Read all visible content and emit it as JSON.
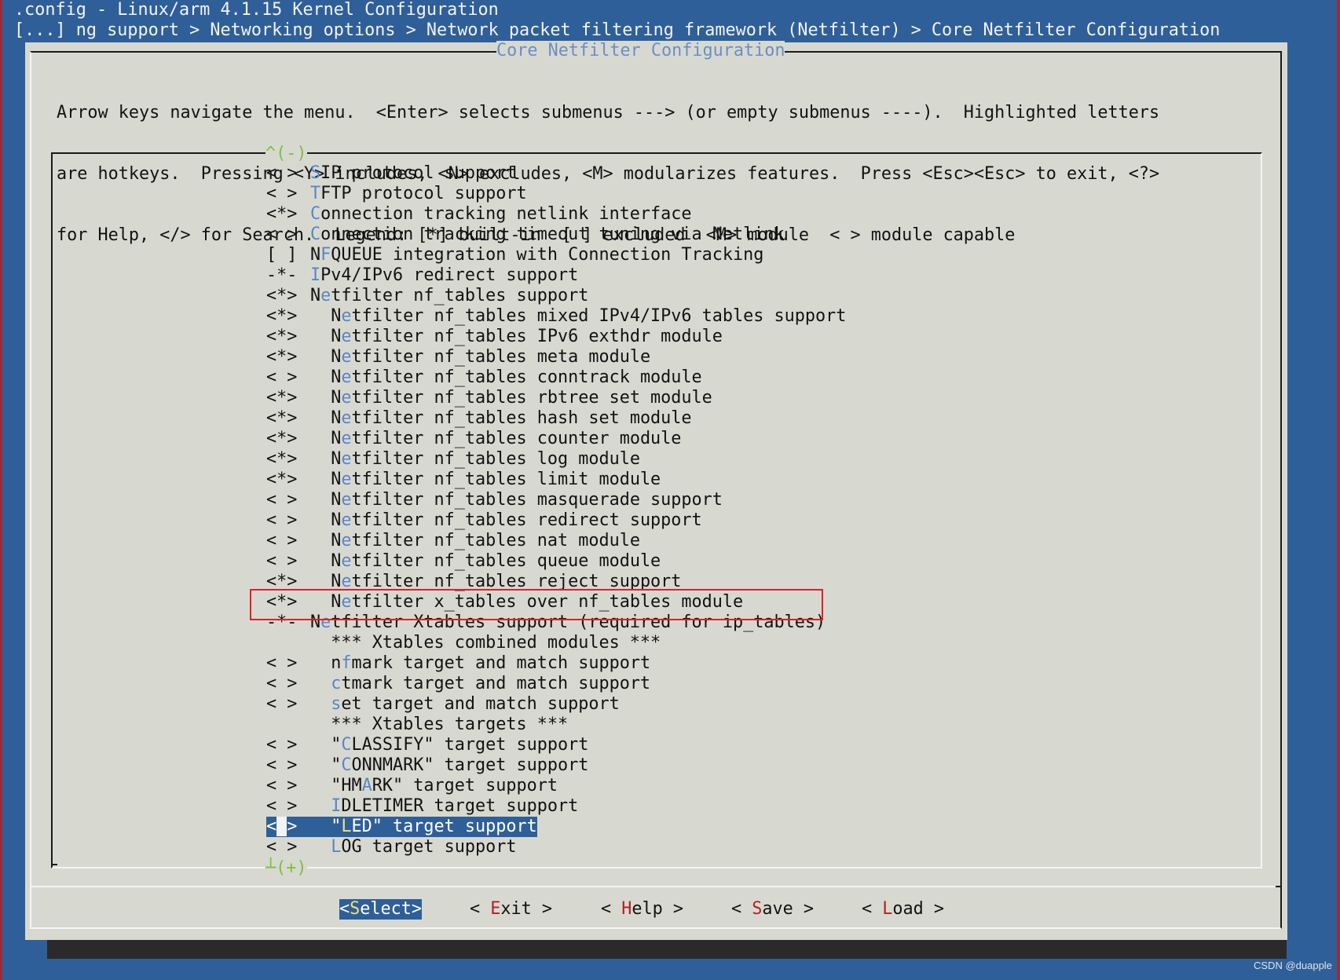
{
  "window": {
    "title": ".config - Linux/arm 4.1.15 Kernel Configuration",
    "breadcrumb": "[...] ng support > Networking options > Network packet filtering framework (Netfilter) > Core Netfilter Configuration"
  },
  "dialog": {
    "title": "Core Netfilter Configuration",
    "help_lines": [
      "Arrow keys navigate the menu.  <Enter> selects submenus ---> (or empty submenus ----).  Highlighted letters",
      "are hotkeys.  Pressing <Y> includes, <N> excludes, <M> modularizes features.  Press <Esc><Esc> to exit, <?>",
      "for Help, </> for Search.  Legend: [*] built-in  [ ] excluded  <M> module  < > module capable"
    ],
    "scroll_up": "^(-)",
    "scroll_down": "┴(+)"
  },
  "menu": {
    "highlighted_entry": "Netfilter x_tables over nf_tables module",
    "selected_entry": "\"LED\" target support",
    "items": [
      {
        "state": "< >",
        "indent": "",
        "pre": "",
        "hotkey": "S",
        "post": "IP protocol support"
      },
      {
        "state": "< >",
        "indent": "",
        "pre": "",
        "hotkey": "T",
        "post": "FTP protocol support"
      },
      {
        "state": "<*>",
        "indent": "",
        "pre": "",
        "hotkey": "C",
        "post": "onnection tracking netlink interface"
      },
      {
        "state": "< >",
        "indent": "",
        "pre": "",
        "hotkey": "C",
        "post": "onnection tracking timeout tuning via Netlink"
      },
      {
        "state": "[ ]",
        "indent": "",
        "pre": "N",
        "hotkey": "F",
        "post": "QUEUE integration with Connection Tracking"
      },
      {
        "state": "-*-",
        "indent": "",
        "pre": "",
        "hotkey": "I",
        "post": "Pv4/IPv6 redirect support"
      },
      {
        "state": "<*>",
        "indent": "",
        "pre": "N",
        "hotkey": "e",
        "post": "tfilter nf_tables support"
      },
      {
        "state": "<*>",
        "indent": "  ",
        "pre": "N",
        "hotkey": "e",
        "post": "tfilter nf_tables mixed IPv4/IPv6 tables support"
      },
      {
        "state": "<*>",
        "indent": "  ",
        "pre": "N",
        "hotkey": "e",
        "post": "tfilter nf_tables IPv6 exthdr module"
      },
      {
        "state": "<*>",
        "indent": "  ",
        "pre": "N",
        "hotkey": "e",
        "post": "tfilter nf_tables meta module"
      },
      {
        "state": "< >",
        "indent": "  ",
        "pre": "N",
        "hotkey": "e",
        "post": "tfilter nf_tables conntrack module"
      },
      {
        "state": "<*>",
        "indent": "  ",
        "pre": "N",
        "hotkey": "e",
        "post": "tfilter nf_tables rbtree set module"
      },
      {
        "state": "<*>",
        "indent": "  ",
        "pre": "N",
        "hotkey": "e",
        "post": "tfilter nf_tables hash set module"
      },
      {
        "state": "<*>",
        "indent": "  ",
        "pre": "N",
        "hotkey": "e",
        "post": "tfilter nf_tables counter module"
      },
      {
        "state": "<*>",
        "indent": "  ",
        "pre": "N",
        "hotkey": "e",
        "post": "tfilter nf_tables log module"
      },
      {
        "state": "<*>",
        "indent": "  ",
        "pre": "N",
        "hotkey": "e",
        "post": "tfilter nf_tables limit module"
      },
      {
        "state": "< >",
        "indent": "  ",
        "pre": "N",
        "hotkey": "e",
        "post": "tfilter nf_tables masquerade support"
      },
      {
        "state": "< >",
        "indent": "  ",
        "pre": "N",
        "hotkey": "e",
        "post": "tfilter nf_tables redirect support"
      },
      {
        "state": "< >",
        "indent": "  ",
        "pre": "N",
        "hotkey": "e",
        "post": "tfilter nf_tables nat module"
      },
      {
        "state": "< >",
        "indent": "  ",
        "pre": "N",
        "hotkey": "e",
        "post": "tfilter nf_tables queue module"
      },
      {
        "state": "<*>",
        "indent": "  ",
        "pre": "N",
        "hotkey": "e",
        "post": "tfilter nf_tables reject support"
      },
      {
        "state": "<*>",
        "indent": "  ",
        "pre": "N",
        "hotkey": "e",
        "post": "tfilter x_tables over nf_tables module"
      },
      {
        "state": "-*-",
        "indent": "",
        "pre": "N",
        "hotkey": "e",
        "post": "tfilter Xtables support (required for ip_tables)"
      },
      {
        "state": "",
        "indent": "  ",
        "pre": "*** Xtables combined modules ***",
        "hotkey": "",
        "post": ""
      },
      {
        "state": "< >",
        "indent": "  ",
        "pre": "n",
        "hotkey": "f",
        "post": "mark target and match support"
      },
      {
        "state": "< >",
        "indent": "  ",
        "pre": "",
        "hotkey": "c",
        "post": "tmark target and match support"
      },
      {
        "state": "< >",
        "indent": "  ",
        "pre": "",
        "hotkey": "s",
        "post": "et target and match support"
      },
      {
        "state": "",
        "indent": "  ",
        "pre": "*** Xtables targets ***",
        "hotkey": "",
        "post": ""
      },
      {
        "state": "< >",
        "indent": "  ",
        "pre": "\"",
        "hotkey": "C",
        "post": "LASSIFY\" target support"
      },
      {
        "state": "< >",
        "indent": "  ",
        "pre": "\"",
        "hotkey": "C",
        "post": "ONNMARK\" target support"
      },
      {
        "state": "< >",
        "indent": "  ",
        "pre": "\"HM",
        "hotkey": "A",
        "post": "RK\" target support"
      },
      {
        "state": "< >",
        "indent": "  ",
        "pre": "",
        "hotkey": "I",
        "post": "DLETIMER target support"
      },
      {
        "state": "< >",
        "indent": "  ",
        "pre": "\"",
        "hotkey": "L",
        "post": "ED\" target support",
        "selected": true
      },
      {
        "state": "< >",
        "indent": "  ",
        "pre": "",
        "hotkey": "L",
        "post": "OG target support"
      }
    ]
  },
  "buttons": [
    {
      "name": "select-button",
      "pre": "<",
      "hotkey": "S",
      "post": "elect>",
      "active": true
    },
    {
      "name": "exit-button",
      "pre": "< ",
      "hotkey": "E",
      "post": "xit >",
      "active": false
    },
    {
      "name": "help-button",
      "pre": "< ",
      "hotkey": "H",
      "post": "elp >",
      "active": false
    },
    {
      "name": "save-button",
      "pre": "< ",
      "hotkey": "S",
      "post": "ave >",
      "active": false
    },
    {
      "name": "load-button",
      "pre": "< ",
      "hotkey": "L",
      "post": "oad >",
      "active": false
    }
  ],
  "watermark": "CSDN @duapple",
  "colors": {
    "background": "#2f5f98",
    "dialog": "#d7d9d1",
    "hotkey": "#5b85c6",
    "button_hotkey": "#b41f1f",
    "highlight_box": "#e01f26",
    "scroll_indicator": "#7cc23a"
  }
}
